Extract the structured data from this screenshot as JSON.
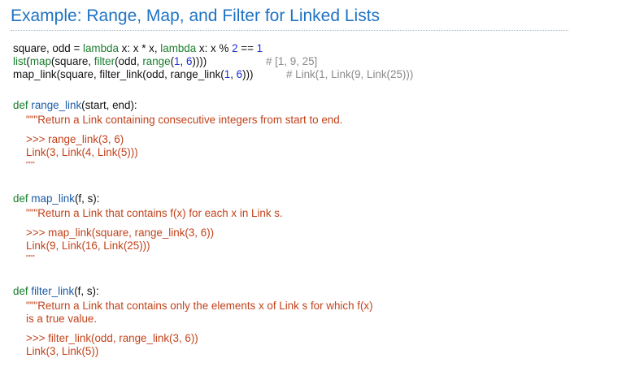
{
  "title": "Example: Range, Map, and Filter for Linked Lists",
  "top_code": {
    "line1": {
      "a": "square, odd = ",
      "kw1": "lambda",
      "b": " x: x * x, ",
      "kw2": "lambda",
      "c": " x: x % ",
      "n1": "2",
      "d": " == ",
      "n2": "1"
    },
    "line2": {
      "kw1": "list",
      "a": "(",
      "kw2": "map",
      "b": "(square, ",
      "kw3": "filter",
      "c": "(odd, ",
      "kw4": "range",
      "d": "(",
      "n1": "1",
      "e": ", ",
      "n2": "6",
      "f": "))))",
      "comment": "# [1, 9, 25]"
    },
    "line3": {
      "code": "map_link(square, filter_link(odd, range_link(",
      "n1": "1",
      "a": ", ",
      "n2": "6",
      "b": ")))",
      "comment": "# Link(1, Link(9, Link(25)))"
    }
  },
  "functions": [
    {
      "def_kw": "def",
      "name": "range_link",
      "params": "(start, end):",
      "doc": "\"\"\"Return a Link containing consecutive integers from start to end.",
      "example": ">>> range_link(3, 6)",
      "result": "Link(3, Link(4, Link(5)))",
      "close": "\"\"\""
    },
    {
      "def_kw": "def",
      "name": "map_link",
      "params": "(f, s):",
      "doc": "\"\"\"Return a Link that contains f(x) for each x in Link s.",
      "example": ">>> map_link(square, range_link(3, 6))",
      "result": "Link(9, Link(16, Link(25)))",
      "close": "\"\"\""
    },
    {
      "def_kw": "def",
      "name": "filter_link",
      "params": "(f, s):",
      "doc": "\"\"\"Return a Link that contains only the elements x of Link s for which f(x)",
      "doc2": "is a true value.",
      "example": ">>> filter_link(odd, range_link(3, 6))",
      "result": "Link(3, Link(5))"
    }
  ],
  "colors": {
    "title": "#1f73c4",
    "keyword": "#177e2c",
    "number": "#1b2fd6",
    "comment": "#8a8a8a",
    "function_name": "#1a5aa6",
    "docstring": "#c2421b"
  }
}
